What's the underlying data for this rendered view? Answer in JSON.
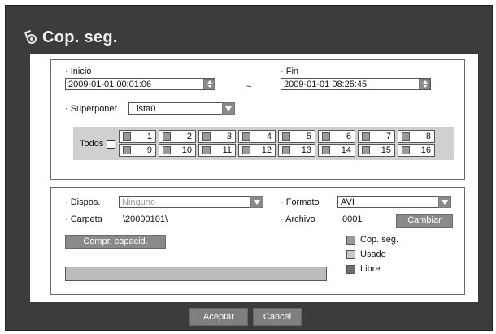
{
  "title": "Cop. seg.",
  "time": {
    "start_label": "· Inicio",
    "start_value": "2009-01-01 00:01:06",
    "tilde": "~",
    "end_label": "· Fin",
    "end_value": "2009-01-01 08:25:45",
    "overlap_label": "· Superponer",
    "overlap_value": "Lista0"
  },
  "channels": {
    "all_label": "Todos",
    "items": [
      "1",
      "2",
      "3",
      "4",
      "5",
      "6",
      "7",
      "8",
      "9",
      "10",
      "11",
      "12",
      "13",
      "14",
      "15",
      "16"
    ]
  },
  "backup": {
    "device_label": "· Dispos.",
    "device_value": "Ninguno",
    "format_label": "· Formato",
    "format_value": "AVI",
    "folder_label": "· Carpeta",
    "folder_value": "\\20090101\\",
    "file_label": "· Archivo",
    "file_value": "0001",
    "change_button": "Cambiar",
    "check_capacity_button": "Compr. capacid.",
    "legend": [
      {
        "label": "Cop. seg.",
        "color": "#9a9a9a"
      },
      {
        "label": "Usado",
        "color": "#c8c8c8"
      },
      {
        "label": "Libre",
        "color": "#6e6e6e"
      }
    ]
  },
  "footer": {
    "ok_button": "Aceptar",
    "cancel_button": "Cancel"
  }
}
